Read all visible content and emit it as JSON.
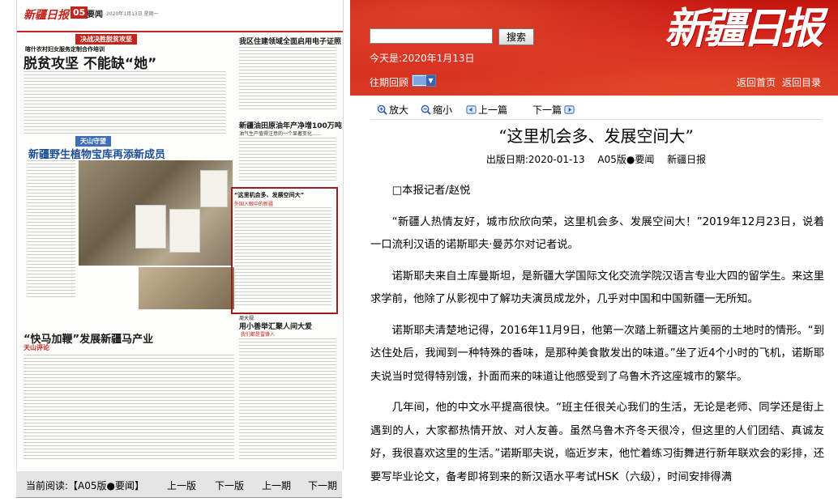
{
  "paper": {
    "masthead_logo": "新疆日报",
    "page_number": "05",
    "section": "要闻",
    "date": "2020年1月13日 星期一",
    "kicker_top": "决战决胜脱贫攻坚",
    "small_head": "喀什农村妇女服务定制合作培训",
    "headline_1": "脱贫攻坚 不能缺“她”",
    "headline_right_1": "我区住建领域全面启用电子证照",
    "headline_right_2": "新疆油田原油年产净增100万吨",
    "headline_right_2_sub": "油气生产值得注意的一个显著变化……",
    "kicker_blue": "天山守望",
    "headline_2": "新疆野生植物宝库再添新成员",
    "highlight_head": "“这里机会多、发展空间大”",
    "highlight_kicker": "外国人眼中的新疆",
    "headline_3": "“快马加鞭”发展新疆马产业",
    "headline_4": "用小善举汇聚人间大爱",
    "headline_4_pre": "周大规",
    "headline_4_sub": "我们都是雷锋人",
    "kicker_tianshan": "天山评论"
  },
  "bottom_nav": {
    "current_label": "当前阅读:【A05版●要闻】",
    "prev_page": "上一版",
    "next_page": "下一版",
    "prev_issue": "上一期",
    "next_issue": "下一期"
  },
  "header": {
    "search_placeholder": "",
    "search_button": "搜索",
    "today": "今天是:2020年1月13日",
    "brand": "新疆日报",
    "past_issues": "往期回顾",
    "home_link": "返回首页",
    "dir_link": "返回目录"
  },
  "toolbar": {
    "zoom_in": "放大",
    "zoom_out": "缩小",
    "prev_article": "上一篇",
    "next_article": "下一篇"
  },
  "article": {
    "title": "“这里机会多、发展空间大”",
    "meta": "出版日期:2020-01-13　 A05版●要闻　 新疆日报",
    "byline": "□本报记者/赵悦",
    "p1": "“新疆人热情友好，城市欣欣向荣，这里机会多、发展空间大！”2019年12月23日，说着一口流利汉语的诺斯耶夫·曼苏尔对记者说。",
    "p2": "诺斯耶夫来自土库曼斯坦，是新疆大学国际文化交流学院汉语言专业大四的留学生。来这里求学前，他除了从影视中了解功夫演员成龙外，几乎对中国和中国新疆一无所知。",
    "p3": "诺斯耶夫清楚地记得，2016年11月9日，他第一次踏上新疆这片美丽的土地时的情形。“到达住处后，我闻到一种特殊的香味，是那种美食散发出的味道。”坐了近4个小时的飞机，诺斯耶夫说当时觉得特别饿，扑面而来的味道让他感受到了乌鲁木齐这座城市的繁华。",
    "p4": "几年间，他的中文水平提高很快。“班主任很关心我们的生活，无论是老师、同学还是街上遇到的人，大家都热情开放、对人友善。虽然乌鲁木齐冬天很冷，但这里的人们团结、真诚友好，我很喜欢这里的生活。”诺斯耶夫说，临近岁末，他忙着练习街舞进行新年联欢会的彩排，还要写毕业论文，备考即将到来的新汉语水平考试HSK（六级），时间安排得满"
  }
}
